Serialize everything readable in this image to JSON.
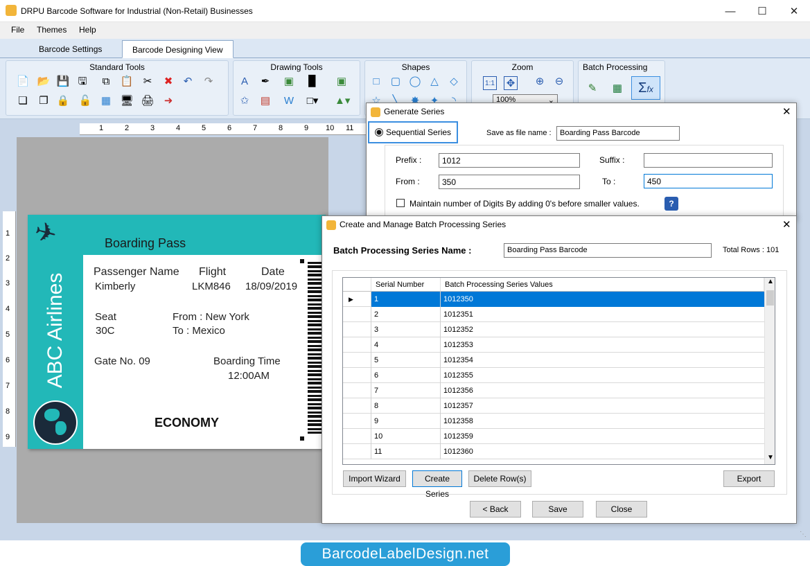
{
  "app": {
    "title": "DRPU Barcode Software for Industrial (Non-Retail) Businesses"
  },
  "menu": {
    "items": [
      "File",
      "Themes",
      "Help"
    ]
  },
  "tabs": [
    "Barcode Settings",
    "Barcode Designing View"
  ],
  "ribbon": {
    "groups": [
      "Standard Tools",
      "Drawing Tools",
      "Shapes",
      "Zoom",
      "Batch Processing"
    ],
    "zoom_value": "100%"
  },
  "ruler": {
    "h_ticks": [
      "1",
      "2",
      "3",
      "4",
      "5",
      "6",
      "7",
      "8",
      "9",
      "10",
      "11"
    ],
    "v_ticks": [
      "1",
      "2",
      "3",
      "4",
      "5",
      "6",
      "7",
      "8",
      "9"
    ]
  },
  "card": {
    "heading": "Boarding Pass",
    "airline": "ABC Airlines",
    "passenger_label": "Passenger Name",
    "passenger_value": "Kimberly",
    "flight_label": "Flight",
    "flight_value": "LKM846",
    "date_label": "Date",
    "date_value": "18/09/2019",
    "seat_label": "Seat",
    "seat_value": "30C",
    "from_text": "From : New York",
    "to_text": "To : Mexico",
    "gate_text": "Gate No. 09",
    "boarding_time_label": "Boarding Time",
    "boarding_time_value": "12:00AM",
    "class_text": "ECONOMY"
  },
  "generate_series": {
    "title": "Generate Series",
    "radio_label": "Sequential Series",
    "save_as_label": "Save as file name :",
    "save_as_value": "Boarding Pass Barcode",
    "prefix_label": "Prefix :",
    "prefix_value": "1012",
    "suffix_label": "Suffix :",
    "suffix_value": "",
    "from_label": "From :",
    "from_value": "350",
    "to_label": "To :",
    "to_value": "450",
    "maintain_label": "Maintain number of Digits By adding 0's before smaller values."
  },
  "batch": {
    "title": "Create and Manage Batch Processing Series",
    "series_name_label": "Batch Processing Series Name :",
    "series_name_value": "Boarding Pass Barcode",
    "total_rows": "Total Rows : 101",
    "columns": [
      "Serial Number",
      "Batch Processing Series Values"
    ],
    "rows": [
      {
        "serial": "1",
        "value": "1012350"
      },
      {
        "serial": "2",
        "value": "1012351"
      },
      {
        "serial": "3",
        "value": "1012352"
      },
      {
        "serial": "4",
        "value": "1012353"
      },
      {
        "serial": "5",
        "value": "1012354"
      },
      {
        "serial": "6",
        "value": "1012355"
      },
      {
        "serial": "7",
        "value": "1012356"
      },
      {
        "serial": "8",
        "value": "1012357"
      },
      {
        "serial": "9",
        "value": "1012358"
      },
      {
        "serial": "10",
        "value": "1012359"
      },
      {
        "serial": "11",
        "value": "1012360"
      }
    ],
    "buttons": {
      "import_wizard": "Import Wizard",
      "create_series": "Create Series",
      "delete_rows": "Delete Row(s)",
      "export": "Export",
      "back": "< Back",
      "save": "Save",
      "close": "Close"
    }
  },
  "brand": {
    "text": "BarcodeLabelDesign.net"
  },
  "colors": {
    "accent": "#0078d7",
    "card_teal": "#22b8b8",
    "brand_blue": "#2a9ed8"
  }
}
